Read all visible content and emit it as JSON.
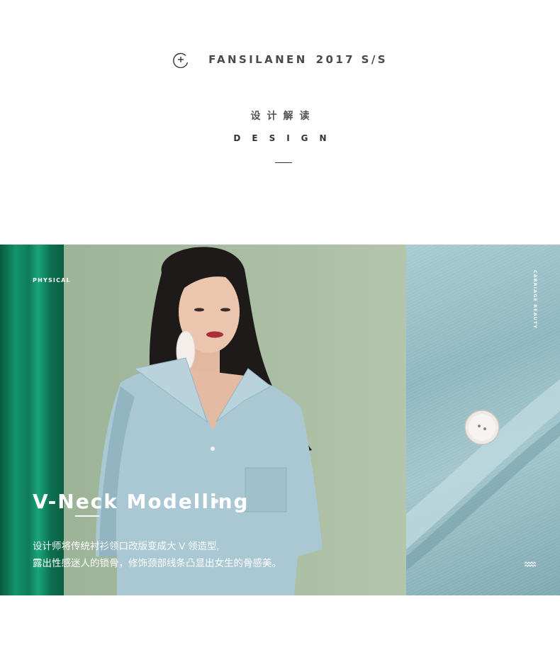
{
  "brand": {
    "name": "FANSILANEN",
    "season": "2017 S/S",
    "icon": "circle-plus-icon"
  },
  "section": {
    "title_cn": "设计解读",
    "title_en": "DESIGN"
  },
  "banner": {
    "label": "PHYSICAL",
    "headline": "V-Neck Modelling",
    "desc_line1": "设计师将传统衬衫领口改版变成大 V 领造型,",
    "desc_line2": "露出性感迷人的锁骨，修饰颈部线条凸显出女生的骨感美。",
    "side_caption": "CARRIAGE BEAUTY",
    "wave_icon": "wave-icon"
  },
  "colors": {
    "text_dark": "#4a4a4a",
    "curtain_green": "#0e7c58",
    "shirt_blue": "#a9cbd2",
    "background_sage": "#a3b99e"
  }
}
